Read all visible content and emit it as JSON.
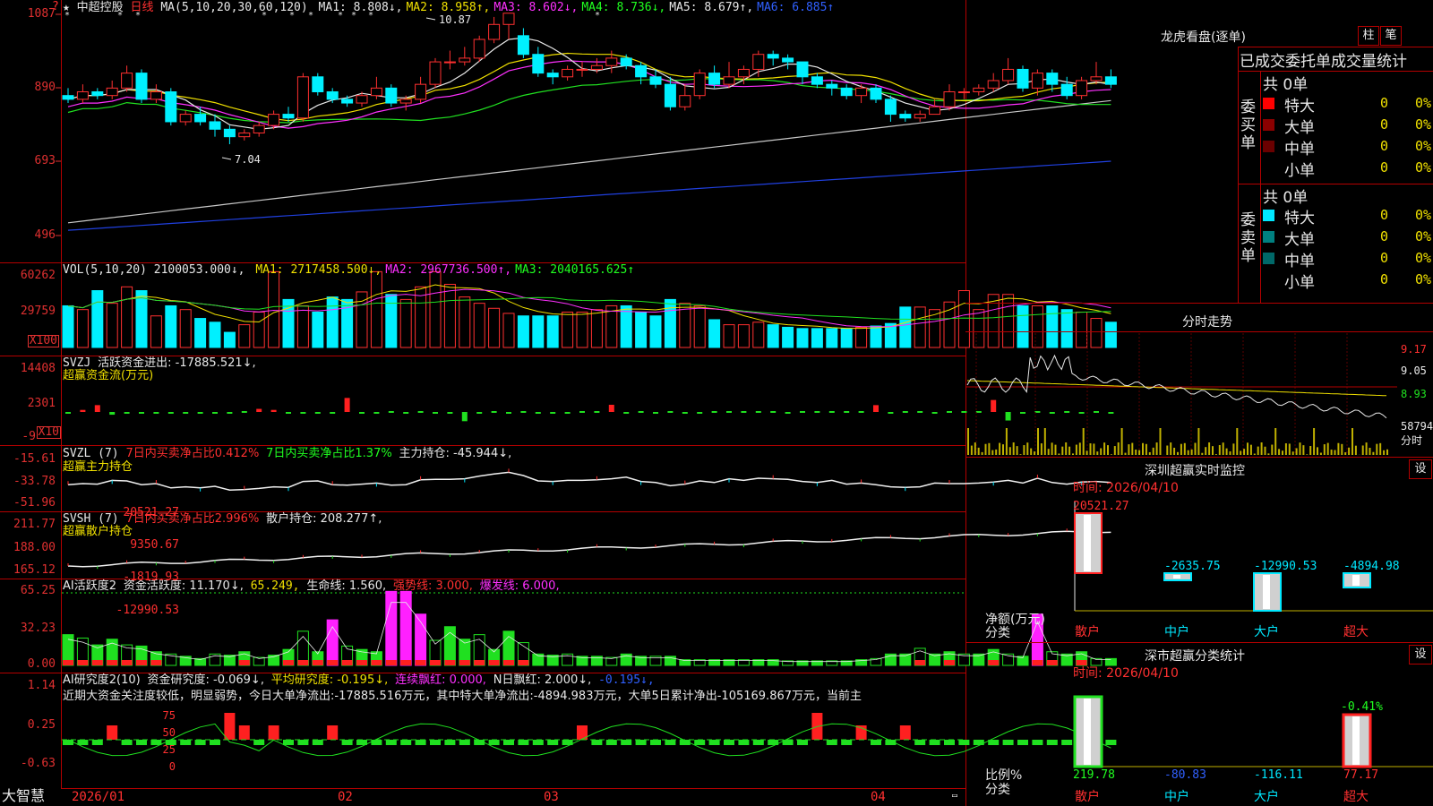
{
  "stock_name": "中超控股",
  "period": "日线",
  "ma_line": {
    "label": "MA(5,10,20,30,60,120)",
    "items": [
      {
        "label": "MA1: 8.808↓,",
        "color": "#e8e8e8"
      },
      {
        "label": "MA2: 8.958↑,",
        "color": "#f0e000"
      },
      {
        "label": "MA3: 8.602↓,",
        "color": "#ff30ff"
      },
      {
        "label": "MA4: 8.736↓,",
        "color": "#20ff20"
      },
      {
        "label": "MA5: 8.679↑,",
        "color": "#e8e8e8"
      },
      {
        "label": "MA6: 6.885↑",
        "color": "#3060ff"
      }
    ]
  },
  "vol_line": {
    "label": "VOL(5,10,20)",
    "value": "2100053.000↓,",
    "items": [
      {
        "label": "MA1: 2717458.500↓,",
        "color": "#f0e000"
      },
      {
        "label": "MA2: 2967736.500↑,",
        "color": "#ff30ff"
      },
      {
        "label": "MA3: 2040165.625↑",
        "color": "#20ff20"
      }
    ]
  },
  "svzj_line": {
    "label": "SVZJ",
    "text": "活跃资金进出: -17885.521↓,",
    "sub": "超赢资金流(万元)"
  },
  "svzl_line": {
    "label": "SVZL (7)",
    "t1": "7日内买卖净占比0.412%",
    "t2": "7日内买卖净占比1.37%",
    "t3": "主力持仓: -45.944↓,",
    "sub": "超赢主力持仓"
  },
  "svsh_line": {
    "label": "SVSH (7)",
    "t1": "7日内买卖净占比2.996%",
    "t2": "散户持仓: 208.277↑,",
    "sub": "超赢散户持仓"
  },
  "ai_line": {
    "label": "AI活跃度2",
    "t1": "资金活跃度: 11.170↓,",
    "t2": "65.249,",
    "t3": "生命线: 1.560,",
    "t4": "强势线: 3.000,",
    "t5": "爆发线: 6.000,"
  },
  "ai2_line": {
    "label": "AI研究度2(10)",
    "t1": "资金研究度: -0.069↓,",
    "t2": "平均研究度: -0.195↓,",
    "t3": "连续飘红: 0.000,",
    "t4": "N日飘红: 2.000↓,",
    "t5": "-0.195↓,",
    "comment": "近期大资金关注度较低，明显弱势，今日大单净流出:-17885.516万元，其中特大单净流出:-4894.983万元，大单5日累计净出-105169.867万元，当前主"
  },
  "price_axis": [
    "1087",
    "890",
    "693",
    "496"
  ],
  "vol_axis": [
    "60262",
    "29759",
    "X100"
  ],
  "svzj_axis": [
    "14408",
    "2301",
    "-9",
    "X10"
  ],
  "svzl_axis": [
    "-15.61",
    "-33.78",
    "-51.96"
  ],
  "svsh_axis": [
    "211.77",
    "188.00",
    "165.12"
  ],
  "ai_axis": [
    "65.25",
    "32.23",
    "0.00"
  ],
  "ai2_axis": [
    "1.14",
    "0.25",
    "-0.63"
  ],
  "date_axis": [
    "2026/01",
    "02",
    "03",
    "04"
  ],
  "brand": "大智慧",
  "high_label": "10.87",
  "low_label": "7.04",
  "lhb": {
    "title": "龙虎看盘(逐单)",
    "btn1": "柱",
    "btn2": "笔",
    "header": "已成交委托单成交量统计",
    "buy_label": "委买单",
    "sell_label": "委卖单",
    "buy_total": "共 0单",
    "sell_total": "共 0单",
    "buy_rows": [
      {
        "name": "特大",
        "count": "0",
        "pct": "0%",
        "color": "#ff0000"
      },
      {
        "name": "大单",
        "count": "0",
        "pct": "0%",
        "color": "#8b0000"
      },
      {
        "name": "中单",
        "count": "0",
        "pct": "0%",
        "color": "#6a0000"
      },
      {
        "name": "小单",
        "count": "0",
        "pct": "0%",
        "color": ""
      }
    ],
    "sell_rows": [
      {
        "name": "特大",
        "count": "0",
        "pct": "0%",
        "color": "#00e8ff"
      },
      {
        "name": "大单",
        "count": "0",
        "pct": "0%",
        "color": "#008080"
      },
      {
        "name": "中单",
        "count": "0",
        "pct": "0%",
        "color": "#006868"
      },
      {
        "name": "小单",
        "count": "0",
        "pct": "0%",
        "color": ""
      }
    ]
  },
  "fenshi": {
    "title": "分时走势",
    "axis": [
      "9.17",
      "9.05",
      "8.93",
      "58794",
      "分时"
    ]
  },
  "sz_monitor": {
    "title": "深圳超赢实时监控",
    "btn": "设",
    "time": "时间: 2026/04/10",
    "axis": [
      "20521.27",
      "9350.67",
      "-1819.93",
      "-12990.53"
    ],
    "unit": "净额(万元)",
    "cat_label": "分类",
    "categories": [
      "散户",
      "中户",
      "大户",
      "超大"
    ],
    "value_labels": [
      "20521.27",
      "-2635.75",
      "-12990.53",
      "-4894.98"
    ]
  },
  "sz_class": {
    "title": "深市超赢分类统计",
    "btn": "设",
    "time": "时间: 2026/04/10",
    "axis": [
      "75",
      "50",
      "25",
      "0"
    ],
    "unit": "比例%",
    "cat_label": "分类",
    "categories": [
      "散户",
      "中户",
      "大户",
      "超大"
    ],
    "values": [
      "219.78",
      "-80.83",
      "-116.11",
      "77.17"
    ],
    "top_label": "-0.41%"
  },
  "chart_data": [
    {
      "type": "candlestick",
      "title": "中超控股 日线",
      "ylim": [
        4.96,
        10.87
      ],
      "y_ticks": [
        10.87,
        8.9,
        6.93,
        4.96
      ],
      "candles": [
        [
          8.7,
          8.6,
          8.9,
          8.5
        ],
        [
          8.6,
          8.8,
          9.0,
          8.5
        ],
        [
          8.8,
          8.7,
          8.9,
          8.6
        ],
        [
          8.7,
          8.9,
          9.1,
          8.6
        ],
        [
          8.9,
          9.3,
          9.5,
          8.8
        ],
        [
          9.3,
          8.6,
          9.4,
          8.5
        ],
        [
          8.6,
          8.8,
          9.0,
          8.5
        ],
        [
          8.8,
          8.0,
          8.9,
          7.9
        ],
        [
          8.0,
          8.2,
          8.3,
          7.9
        ],
        [
          8.2,
          8.0,
          8.4,
          7.9
        ],
        [
          8.0,
          7.8,
          8.2,
          7.6
        ],
        [
          7.8,
          7.6,
          7.9,
          7.4
        ],
        [
          7.6,
          7.7,
          7.8,
          7.5
        ],
        [
          7.7,
          7.9,
          8.0,
          7.6
        ],
        [
          7.9,
          8.2,
          8.3,
          7.8
        ],
        [
          8.2,
          8.1,
          8.4,
          8.0
        ],
        [
          8.1,
          9.2,
          9.3,
          8.0
        ],
        [
          9.2,
          8.8,
          9.3,
          8.7
        ],
        [
          8.8,
          8.6,
          8.9,
          8.5
        ],
        [
          8.6,
          8.5,
          8.7,
          8.4
        ],
        [
          8.5,
          8.7,
          8.8,
          8.4
        ],
        [
          8.7,
          8.9,
          9.2,
          8.6
        ],
        [
          8.9,
          8.5,
          9.0,
          8.4
        ],
        [
          8.5,
          8.6,
          8.7,
          8.3
        ],
        [
          8.6,
          9.0,
          9.2,
          8.5
        ],
        [
          9.0,
          9.6,
          9.7,
          8.9
        ],
        [
          9.6,
          9.6,
          9.9,
          9.4
        ],
        [
          9.6,
          9.7,
          10.0,
          9.5
        ],
        [
          9.7,
          10.2,
          10.3,
          9.6
        ],
        [
          10.2,
          10.6,
          10.8,
          10.1
        ],
        [
          10.6,
          10.9,
          10.9,
          10.2
        ],
        [
          10.3,
          9.8,
          10.5,
          9.7
        ],
        [
          9.8,
          9.3,
          10.0,
          9.2
        ],
        [
          9.3,
          9.2,
          9.4,
          9.0
        ],
        [
          9.2,
          9.4,
          9.5,
          9.1
        ],
        [
          9.4,
          9.4,
          9.6,
          9.2
        ],
        [
          9.4,
          9.5,
          9.7,
          9.3
        ],
        [
          9.5,
          9.7,
          9.9,
          9.3
        ],
        [
          9.7,
          9.5,
          9.8,
          9.4
        ],
        [
          9.5,
          9.2,
          9.6,
          9.0
        ],
        [
          9.2,
          9.0,
          9.4,
          8.9
        ],
        [
          9.0,
          8.4,
          9.2,
          8.3
        ],
        [
          8.4,
          8.7,
          9.0,
          8.3
        ],
        [
          8.7,
          9.3,
          9.4,
          8.6
        ],
        [
          9.3,
          9.0,
          9.5,
          8.9
        ],
        [
          9.0,
          9.2,
          9.6,
          8.9
        ],
        [
          9.2,
          9.4,
          9.5,
          9.0
        ],
        [
          9.4,
          9.8,
          9.9,
          9.2
        ],
        [
          9.8,
          9.7,
          9.9,
          9.5
        ],
        [
          9.7,
          9.6,
          9.8,
          9.4
        ],
        [
          9.6,
          9.2,
          9.6,
          9.0
        ],
        [
          9.2,
          9.0,
          9.3,
          8.9
        ],
        [
          9.0,
          8.9,
          9.1,
          8.7
        ],
        [
          8.9,
          8.7,
          9.0,
          8.6
        ],
        [
          8.7,
          8.9,
          9.0,
          8.5
        ],
        [
          8.9,
          8.6,
          9.0,
          8.5
        ],
        [
          8.6,
          8.2,
          8.7,
          8.0
        ],
        [
          8.2,
          8.1,
          8.3,
          8.0
        ],
        [
          8.1,
          8.2,
          8.3,
          8.0
        ],
        [
          8.2,
          8.4,
          8.6,
          8.2
        ],
        [
          8.4,
          8.8,
          9.0,
          8.3
        ],
        [
          8.8,
          8.8,
          8.9,
          8.6
        ],
        [
          8.8,
          8.9,
          9.0,
          8.7
        ],
        [
          8.9,
          9.1,
          9.3,
          8.8
        ],
        [
          9.1,
          9.4,
          9.7,
          9.0
        ],
        [
          9.4,
          8.9,
          9.5,
          8.8
        ],
        [
          8.9,
          9.3,
          9.4,
          8.7
        ],
        [
          9.3,
          9.0,
          9.4,
          8.8
        ],
        [
          9.0,
          8.7,
          9.2,
          8.6
        ],
        [
          8.7,
          9.1,
          9.2,
          8.6
        ],
        [
          9.1,
          9.2,
          9.6,
          9.0
        ],
        [
          9.2,
          9.0,
          9.4,
          8.9
        ]
      ]
    },
    {
      "type": "bar",
      "title": "VOL(5,10,20)",
      "ylim": [
        0,
        60262
      ],
      "values": [
        33000,
        30000,
        45000,
        35000,
        48000,
        45000,
        25000,
        33000,
        30000,
        23000,
        20000,
        12000,
        18000,
        28000,
        60000,
        38000,
        33000,
        28000,
        40000,
        38000,
        44000,
        60000,
        42000,
        38000,
        48000,
        60000,
        50000,
        40000,
        35000,
        31000,
        27000,
        25000,
        25000,
        25000,
        28000,
        28000,
        30000,
        33000,
        33000,
        28000,
        25000,
        38000,
        35000,
        33000,
        22000,
        18000,
        18000,
        20000,
        18000,
        16000,
        15000,
        15000,
        15000,
        15000,
        16000,
        17000,
        19000,
        32000,
        32000,
        30000,
        36000,
        45000,
        30000,
        42000,
        42000,
        33000,
        33000,
        33000,
        30000,
        28000,
        23000,
        20000
      ]
    },
    {
      "type": "bar",
      "title": "超赢资金流(万元)",
      "ylim": [
        -900,
        14408
      ],
      "values": [
        -300,
        600,
        2000,
        -800,
        -200,
        -100,
        -100,
        -100,
        -50,
        -200,
        -300,
        -100,
        0,
        900,
        600,
        -400,
        -200,
        -100,
        -300,
        4100,
        -400,
        -200,
        0,
        -100,
        0,
        -50,
        -100,
        -2700,
        -200,
        0,
        -100,
        0,
        -50,
        -50,
        -50,
        0,
        0,
        2100,
        -500,
        0,
        -50,
        0,
        -200,
        -100,
        0,
        0,
        0,
        0,
        0,
        -50,
        0,
        0,
        0,
        0,
        0,
        2000,
        -100,
        0,
        0,
        -200,
        0,
        0,
        0,
        3500,
        -2500,
        -200,
        0,
        -100,
        0,
        -100,
        0,
        -200
      ]
    },
    {
      "type": "bar",
      "title": "超赢资金关注度",
      "ylim": [
        0,
        65.25
      ],
      "values": [
        27,
        24,
        18,
        23,
        18,
        17,
        12,
        10,
        8,
        6,
        10,
        9,
        12,
        7,
        9,
        14,
        30,
        12,
        40,
        17,
        14,
        12,
        65,
        65,
        45,
        22,
        34,
        23,
        27,
        14,
        30,
        20,
        10,
        9,
        10,
        8,
        8,
        7,
        10,
        8,
        8,
        8,
        5,
        5,
        5,
        5,
        5,
        5,
        5,
        4,
        4,
        4,
        4,
        4,
        5,
        6,
        10,
        10,
        15,
        10,
        12,
        10,
        10,
        14,
        10,
        8,
        45,
        12,
        10,
        12,
        6,
        6
      ]
    }
  ]
}
